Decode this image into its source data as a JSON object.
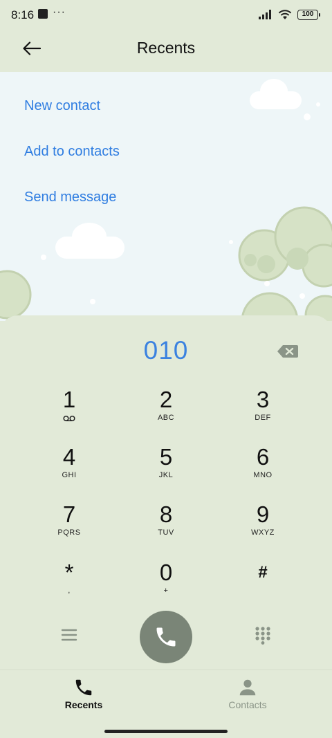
{
  "status_bar": {
    "time": "8:16",
    "more": "···",
    "battery": "100"
  },
  "header": {
    "title": "Recents"
  },
  "actions": [
    {
      "label": "New contact"
    },
    {
      "label": "Add to contacts"
    },
    {
      "label": "Send message"
    }
  ],
  "dialer": {
    "number": "010",
    "keys": [
      {
        "digit": "1",
        "letters": ""
      },
      {
        "digit": "2",
        "letters": "ABC"
      },
      {
        "digit": "3",
        "letters": "DEF"
      },
      {
        "digit": "4",
        "letters": "GHI"
      },
      {
        "digit": "5",
        "letters": "JKL"
      },
      {
        "digit": "6",
        "letters": "MNO"
      },
      {
        "digit": "7",
        "letters": "PQRS"
      },
      {
        "digit": "8",
        "letters": "TUV"
      },
      {
        "digit": "9",
        "letters": "WXYZ"
      },
      {
        "digit": "*",
        "letters": ","
      },
      {
        "digit": "0",
        "letters": "+"
      },
      {
        "digit": "#",
        "letters": ""
      }
    ]
  },
  "bottom_nav": {
    "items": [
      {
        "label": "Recents",
        "icon": "phone-icon",
        "active": true
      },
      {
        "label": "Contacts",
        "icon": "person-icon",
        "active": false
      }
    ]
  },
  "colors": {
    "background": "#e2ead8",
    "accent": "#3b82e0",
    "link": "#2f7de1",
    "call_button": "#7a8577",
    "inactive": "#8a9487"
  }
}
